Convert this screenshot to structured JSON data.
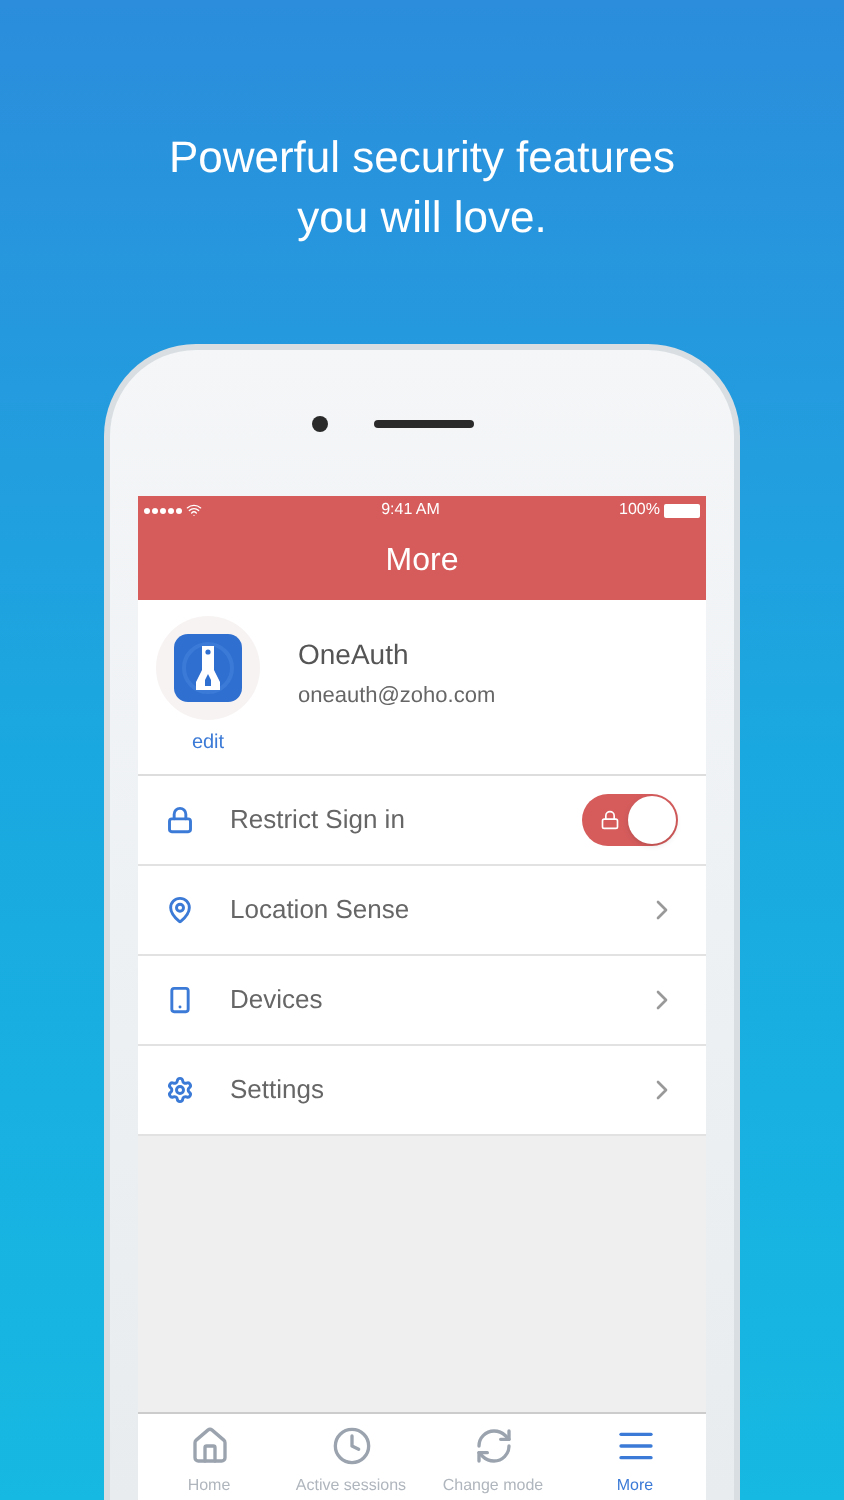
{
  "headline": [
    "Powerful security features",
    "you will love."
  ],
  "status_bar": {
    "time": "9:41 AM",
    "battery": "100%"
  },
  "header": {
    "title": "More"
  },
  "profile": {
    "name": "OneAuth",
    "email": "oneauth@zoho.com",
    "edit": "edit"
  },
  "settings": [
    {
      "kind": "toggle",
      "label": "Restrict Sign in",
      "on": true
    },
    {
      "kind": "link",
      "label": "Location Sense"
    },
    {
      "kind": "link",
      "label": "Devices"
    },
    {
      "kind": "link",
      "label": "Settings"
    }
  ],
  "tab_bar": [
    {
      "label": "Home",
      "selected": false
    },
    {
      "label": "Active sessions",
      "selected": false
    },
    {
      "label": "Change mode",
      "selected": false
    },
    {
      "label": "More",
      "selected": true
    }
  ]
}
